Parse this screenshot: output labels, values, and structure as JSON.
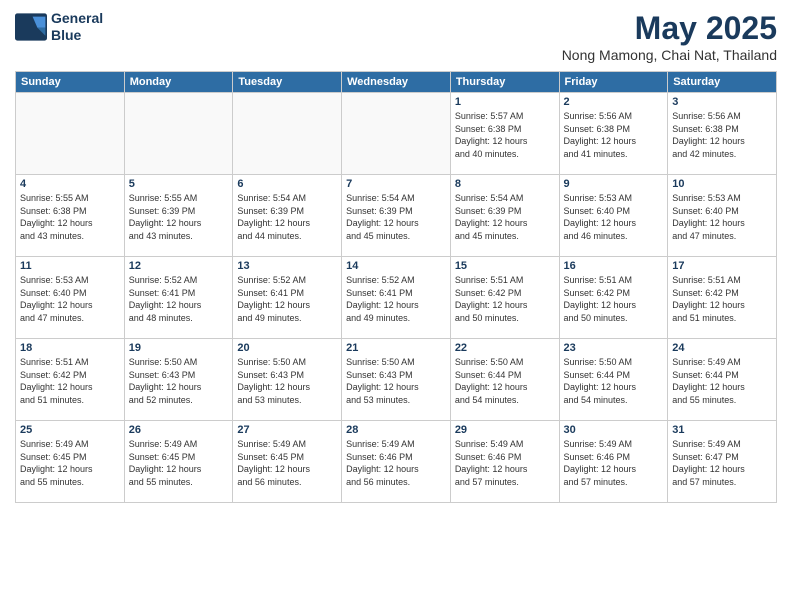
{
  "header": {
    "logo_line1": "General",
    "logo_line2": "Blue",
    "title": "May 2025",
    "subtitle": "Nong Mamong, Chai Nat, Thailand"
  },
  "days_of_week": [
    "Sunday",
    "Monday",
    "Tuesday",
    "Wednesday",
    "Thursday",
    "Friday",
    "Saturday"
  ],
  "weeks": [
    [
      {
        "day": "",
        "info": ""
      },
      {
        "day": "",
        "info": ""
      },
      {
        "day": "",
        "info": ""
      },
      {
        "day": "",
        "info": ""
      },
      {
        "day": "1",
        "info": "Sunrise: 5:57 AM\nSunset: 6:38 PM\nDaylight: 12 hours\nand 40 minutes."
      },
      {
        "day": "2",
        "info": "Sunrise: 5:56 AM\nSunset: 6:38 PM\nDaylight: 12 hours\nand 41 minutes."
      },
      {
        "day": "3",
        "info": "Sunrise: 5:56 AM\nSunset: 6:38 PM\nDaylight: 12 hours\nand 42 minutes."
      }
    ],
    [
      {
        "day": "4",
        "info": "Sunrise: 5:55 AM\nSunset: 6:38 PM\nDaylight: 12 hours\nand 43 minutes."
      },
      {
        "day": "5",
        "info": "Sunrise: 5:55 AM\nSunset: 6:39 PM\nDaylight: 12 hours\nand 43 minutes."
      },
      {
        "day": "6",
        "info": "Sunrise: 5:54 AM\nSunset: 6:39 PM\nDaylight: 12 hours\nand 44 minutes."
      },
      {
        "day": "7",
        "info": "Sunrise: 5:54 AM\nSunset: 6:39 PM\nDaylight: 12 hours\nand 45 minutes."
      },
      {
        "day": "8",
        "info": "Sunrise: 5:54 AM\nSunset: 6:39 PM\nDaylight: 12 hours\nand 45 minutes."
      },
      {
        "day": "9",
        "info": "Sunrise: 5:53 AM\nSunset: 6:40 PM\nDaylight: 12 hours\nand 46 minutes."
      },
      {
        "day": "10",
        "info": "Sunrise: 5:53 AM\nSunset: 6:40 PM\nDaylight: 12 hours\nand 47 minutes."
      }
    ],
    [
      {
        "day": "11",
        "info": "Sunrise: 5:53 AM\nSunset: 6:40 PM\nDaylight: 12 hours\nand 47 minutes."
      },
      {
        "day": "12",
        "info": "Sunrise: 5:52 AM\nSunset: 6:41 PM\nDaylight: 12 hours\nand 48 minutes."
      },
      {
        "day": "13",
        "info": "Sunrise: 5:52 AM\nSunset: 6:41 PM\nDaylight: 12 hours\nand 49 minutes."
      },
      {
        "day": "14",
        "info": "Sunrise: 5:52 AM\nSunset: 6:41 PM\nDaylight: 12 hours\nand 49 minutes."
      },
      {
        "day": "15",
        "info": "Sunrise: 5:51 AM\nSunset: 6:42 PM\nDaylight: 12 hours\nand 50 minutes."
      },
      {
        "day": "16",
        "info": "Sunrise: 5:51 AM\nSunset: 6:42 PM\nDaylight: 12 hours\nand 50 minutes."
      },
      {
        "day": "17",
        "info": "Sunrise: 5:51 AM\nSunset: 6:42 PM\nDaylight: 12 hours\nand 51 minutes."
      }
    ],
    [
      {
        "day": "18",
        "info": "Sunrise: 5:51 AM\nSunset: 6:42 PM\nDaylight: 12 hours\nand 51 minutes."
      },
      {
        "day": "19",
        "info": "Sunrise: 5:50 AM\nSunset: 6:43 PM\nDaylight: 12 hours\nand 52 minutes."
      },
      {
        "day": "20",
        "info": "Sunrise: 5:50 AM\nSunset: 6:43 PM\nDaylight: 12 hours\nand 53 minutes."
      },
      {
        "day": "21",
        "info": "Sunrise: 5:50 AM\nSunset: 6:43 PM\nDaylight: 12 hours\nand 53 minutes."
      },
      {
        "day": "22",
        "info": "Sunrise: 5:50 AM\nSunset: 6:44 PM\nDaylight: 12 hours\nand 54 minutes."
      },
      {
        "day": "23",
        "info": "Sunrise: 5:50 AM\nSunset: 6:44 PM\nDaylight: 12 hours\nand 54 minutes."
      },
      {
        "day": "24",
        "info": "Sunrise: 5:49 AM\nSunset: 6:44 PM\nDaylight: 12 hours\nand 55 minutes."
      }
    ],
    [
      {
        "day": "25",
        "info": "Sunrise: 5:49 AM\nSunset: 6:45 PM\nDaylight: 12 hours\nand 55 minutes."
      },
      {
        "day": "26",
        "info": "Sunrise: 5:49 AM\nSunset: 6:45 PM\nDaylight: 12 hours\nand 55 minutes."
      },
      {
        "day": "27",
        "info": "Sunrise: 5:49 AM\nSunset: 6:45 PM\nDaylight: 12 hours\nand 56 minutes."
      },
      {
        "day": "28",
        "info": "Sunrise: 5:49 AM\nSunset: 6:46 PM\nDaylight: 12 hours\nand 56 minutes."
      },
      {
        "day": "29",
        "info": "Sunrise: 5:49 AM\nSunset: 6:46 PM\nDaylight: 12 hours\nand 57 minutes."
      },
      {
        "day": "30",
        "info": "Sunrise: 5:49 AM\nSunset: 6:46 PM\nDaylight: 12 hours\nand 57 minutes."
      },
      {
        "day": "31",
        "info": "Sunrise: 5:49 AM\nSunset: 6:47 PM\nDaylight: 12 hours\nand 57 minutes."
      }
    ]
  ]
}
